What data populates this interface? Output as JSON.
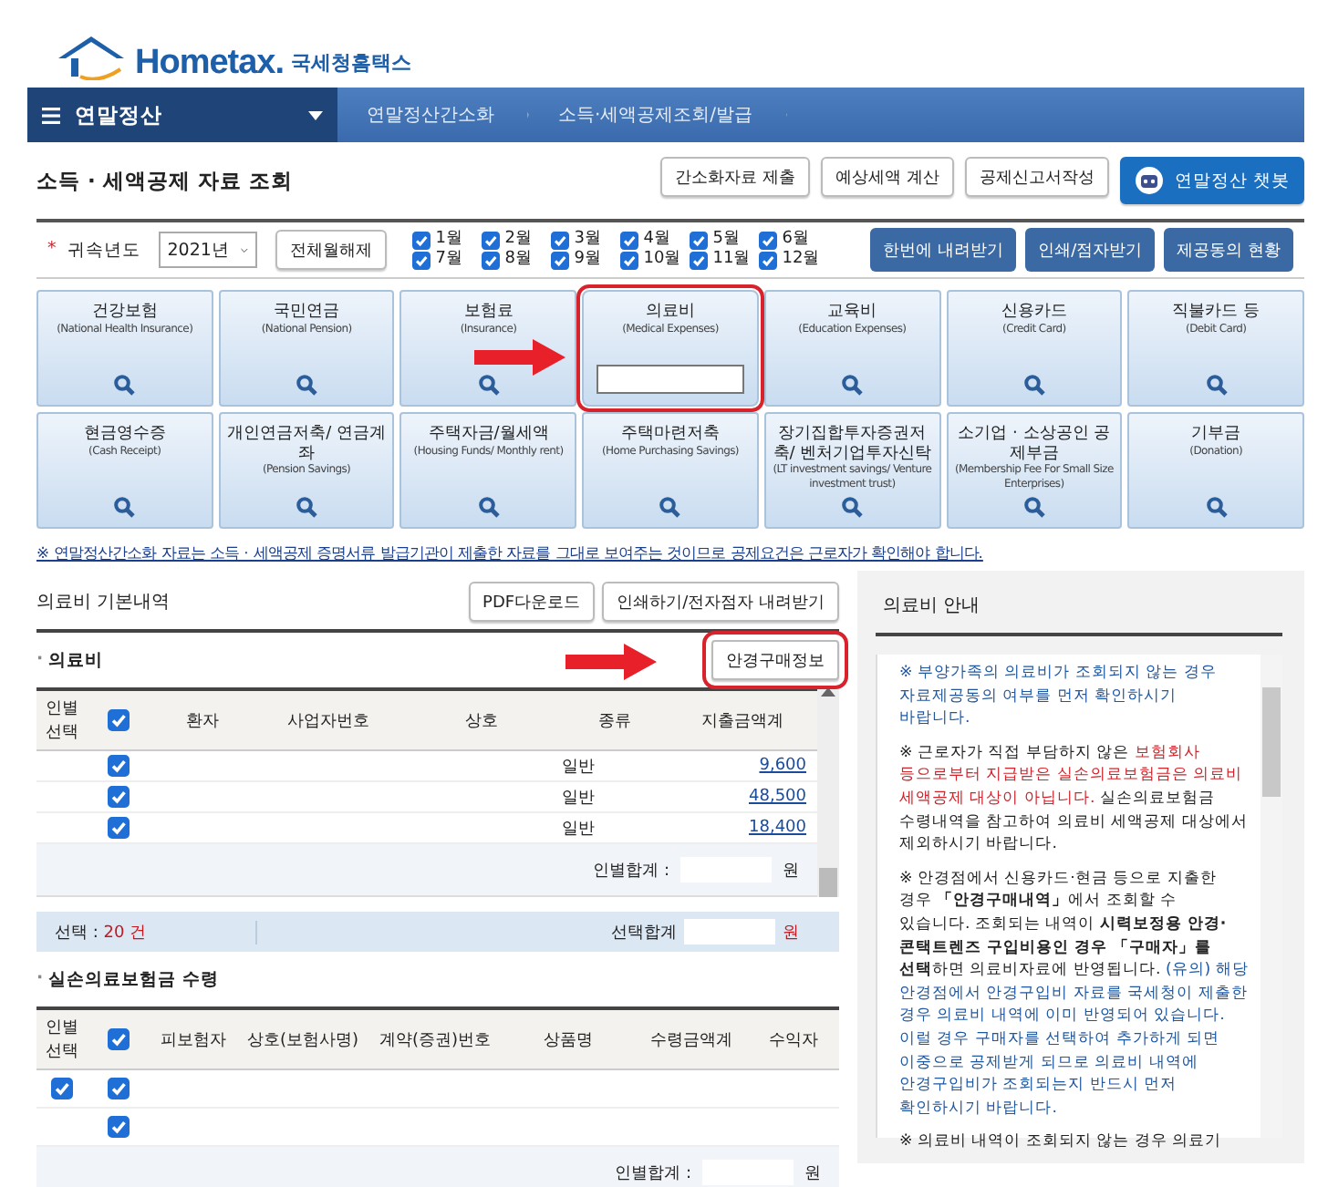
{
  "logo": {
    "brand": "Hometax.",
    "name": "국세청홈택스"
  },
  "nav": {
    "menu_label": "연말정산",
    "crumbs": [
      "연말정산간소화",
      "소득·세액공제조회/발급"
    ]
  },
  "page_title": "소득 · 세액공제 자료 조회",
  "header_buttons": [
    {
      "label": "간소화자료 제출",
      "kind": "plain"
    },
    {
      "label": "예상세액 계산",
      "kind": "plain"
    },
    {
      "label": "공제신고서작성",
      "kind": "plain"
    },
    {
      "label": "연말정산 챗봇",
      "kind": "chatbot"
    }
  ],
  "filter": {
    "required_mark": "*",
    "label": "귀속년도",
    "year": "2021년",
    "clear_button": "전체월해제",
    "months": [
      {
        "label": "1월",
        "checked": true
      },
      {
        "label": "2월",
        "checked": true
      },
      {
        "label": "3월",
        "checked": true
      },
      {
        "label": "4월",
        "checked": true
      },
      {
        "label": "5월",
        "checked": true
      },
      {
        "label": "6월",
        "checked": true
      },
      {
        "label": "7월",
        "checked": true
      },
      {
        "label": "8월",
        "checked": true
      },
      {
        "label": "9월",
        "checked": true
      },
      {
        "label": "10월",
        "checked": true
      },
      {
        "label": "11월",
        "checked": true
      },
      {
        "label": "12월",
        "checked": true
      }
    ],
    "buttons": [
      "한번에 내려받기",
      "인쇄/점자받기",
      "제공동의 현황"
    ]
  },
  "tiles": [
    {
      "title": "건강보험",
      "subtitle": "(National Health Insurance)",
      "kind": "search",
      "highlighted": false
    },
    {
      "title": "국민연금",
      "subtitle": "(National Pension)",
      "kind": "search",
      "highlighted": false
    },
    {
      "title": "보험료",
      "subtitle": "(Insurance)",
      "kind": "search",
      "highlighted": false
    },
    {
      "title": "의료비",
      "subtitle": "(Medical Expenses)",
      "kind": "input",
      "highlighted": true
    },
    {
      "title": "교육비",
      "subtitle": "(Education Expenses)",
      "kind": "search",
      "highlighted": false
    },
    {
      "title": "신용카드",
      "subtitle": "(Credit Card)",
      "kind": "search",
      "highlighted": false
    },
    {
      "title": "직불카드 등",
      "subtitle": "(Debit Card)",
      "kind": "search",
      "highlighted": false
    },
    {
      "title": "현금영수증",
      "subtitle": "(Cash Receipt)",
      "kind": "search",
      "highlighted": false
    },
    {
      "title": "개인연금저축/ 연금계좌",
      "subtitle": "(Pension Savings)",
      "kind": "search",
      "highlighted": false
    },
    {
      "title": "주택자금/월세액",
      "subtitle": "(Housing Funds/ Monthly rent)",
      "kind": "search",
      "highlighted": false
    },
    {
      "title": "주택마련저축",
      "subtitle": "(Home Purchasing Savings)",
      "kind": "search",
      "highlighted": false
    },
    {
      "title": "장기집합투자증권저축/ 벤처기업투자신탁",
      "subtitle": "(LT investment savings/ Venture investment trust)",
      "kind": "search",
      "highlighted": false
    },
    {
      "title": "소기업 · 소상공인 공제부금",
      "subtitle": "(Membership Fee For Small Size Enterprises)",
      "kind": "search",
      "highlighted": false
    },
    {
      "title": "기부금",
      "subtitle": "(Donation)",
      "kind": "search",
      "highlighted": false
    }
  ],
  "notice": "※ 연말정산간소화 자료는 소득 · 세액공제 증명서류 발급기관이 제출한 자료를 그대로 보여주는 것이므로 공제요건은 근로자가 확인해야 합니다.",
  "detail": {
    "title": "의료비 기본내역",
    "buttons": [
      "PDF다운로드",
      "인쇄하기/전자점자 내려받기"
    ],
    "medical": {
      "bullet": "·",
      "title": "의료비",
      "side_button": {
        "label": "안경구매정보",
        "highlighted": true
      },
      "columns": [
        {
          "kind": "text",
          "label": "인별 선택"
        },
        {
          "kind": "check",
          "checked": true
        },
        {
          "kind": "text",
          "label": "환자"
        },
        {
          "kind": "text",
          "label": "사업자번호"
        },
        {
          "kind": "text",
          "label": "상호"
        },
        {
          "kind": "text",
          "label": "종류"
        },
        {
          "kind": "text",
          "label": "지출금액계"
        }
      ],
      "rows": [
        {
          "checked": true,
          "type": "일반",
          "amount": "9,600"
        },
        {
          "checked": true,
          "type": "일반",
          "amount": "48,500"
        },
        {
          "checked": true,
          "type": "일반",
          "amount": "18,400"
        }
      ],
      "subtotal_label": "인별합계 :",
      "subtotal_unit": "원",
      "selected_label": "선택 : ",
      "selected_count": "20 건",
      "selected_sum_label": "선택합계",
      "selected_sum_unit": "원"
    },
    "insurance": {
      "bullet": "·",
      "title": "실손의료보험금 수령",
      "columns": [
        {
          "kind": "text",
          "label": "인별 선택"
        },
        {
          "kind": "check",
          "checked": true
        },
        {
          "kind": "text",
          "label": "피보험자"
        },
        {
          "kind": "text",
          "label": "상호(보험사명)"
        },
        {
          "kind": "text",
          "label": "계약(증권)번호"
        },
        {
          "kind": "text",
          "label": "상품명"
        },
        {
          "kind": "text",
          "label": "수령금액계"
        },
        {
          "kind": "text",
          "label": "수익자"
        }
      ],
      "rows": [
        {
          "person_check": {
            "checked": true
          },
          "checked": true
        },
        {
          "checked": true
        }
      ],
      "subtotal_label": "인별합계 :",
      "subtotal_unit": "원"
    }
  },
  "guide": {
    "title": "의료비 안내",
    "paragraphs": [
      [
        {
          "kind": "note",
          "text": "※ 부양가족의 의료비가 조회되지 않는 경우 자료제공동의 여부를 먼저 확인하시기 바랍니다."
        }
      ],
      [
        {
          "kind": "plain",
          "text": "※ 근로자가 직접 부담하지 않은 "
        },
        {
          "kind": "warning",
          "text": "보험회사 등으로부터 지급받은 실손의료보험금은 의료비 세액공제 대상이 아닙니다."
        },
        {
          "kind": "plain",
          "text": " 실손의료보험금 수령내역을 참고하여 의료비 세액공제 대상에서 제외하시기 바랍니다."
        }
      ],
      [
        {
          "kind": "plain",
          "text": "※ 안경점에서 신용카드·현금 등으로 지출한 경우 "
        },
        {
          "kind": "strong",
          "text": "「안경구매내역」"
        },
        {
          "kind": "plain",
          "text": "에서 조회할 수 있습니다. 조회되는 내역이 "
        },
        {
          "kind": "strong",
          "text": "시력보정용 안경·콘택트렌즈 구입비용인 경우 「구매자」를 선택"
        },
        {
          "kind": "plain",
          "text": "하면 의료비자료에 반영됩니다. "
        },
        {
          "kind": "note",
          "text": "(유의) 해당 안경점에서 안경구입비 자료를 국세청이 제출한 경우 의료비 내역에 이미 반영되어 있습니다. 이럴 경우 구매자를 선택하여 추가하게 되면 이중으로 공제받게 되므로 의료비 내역에 안경구입비가 조회되는지 반드시 먼저 확인하시기 바랍니다."
        }
      ],
      [
        {
          "kind": "plain",
          "text": "※ 의료비 내역이 조회되지 않는 경우 의료기"
        }
      ]
    ]
  }
}
